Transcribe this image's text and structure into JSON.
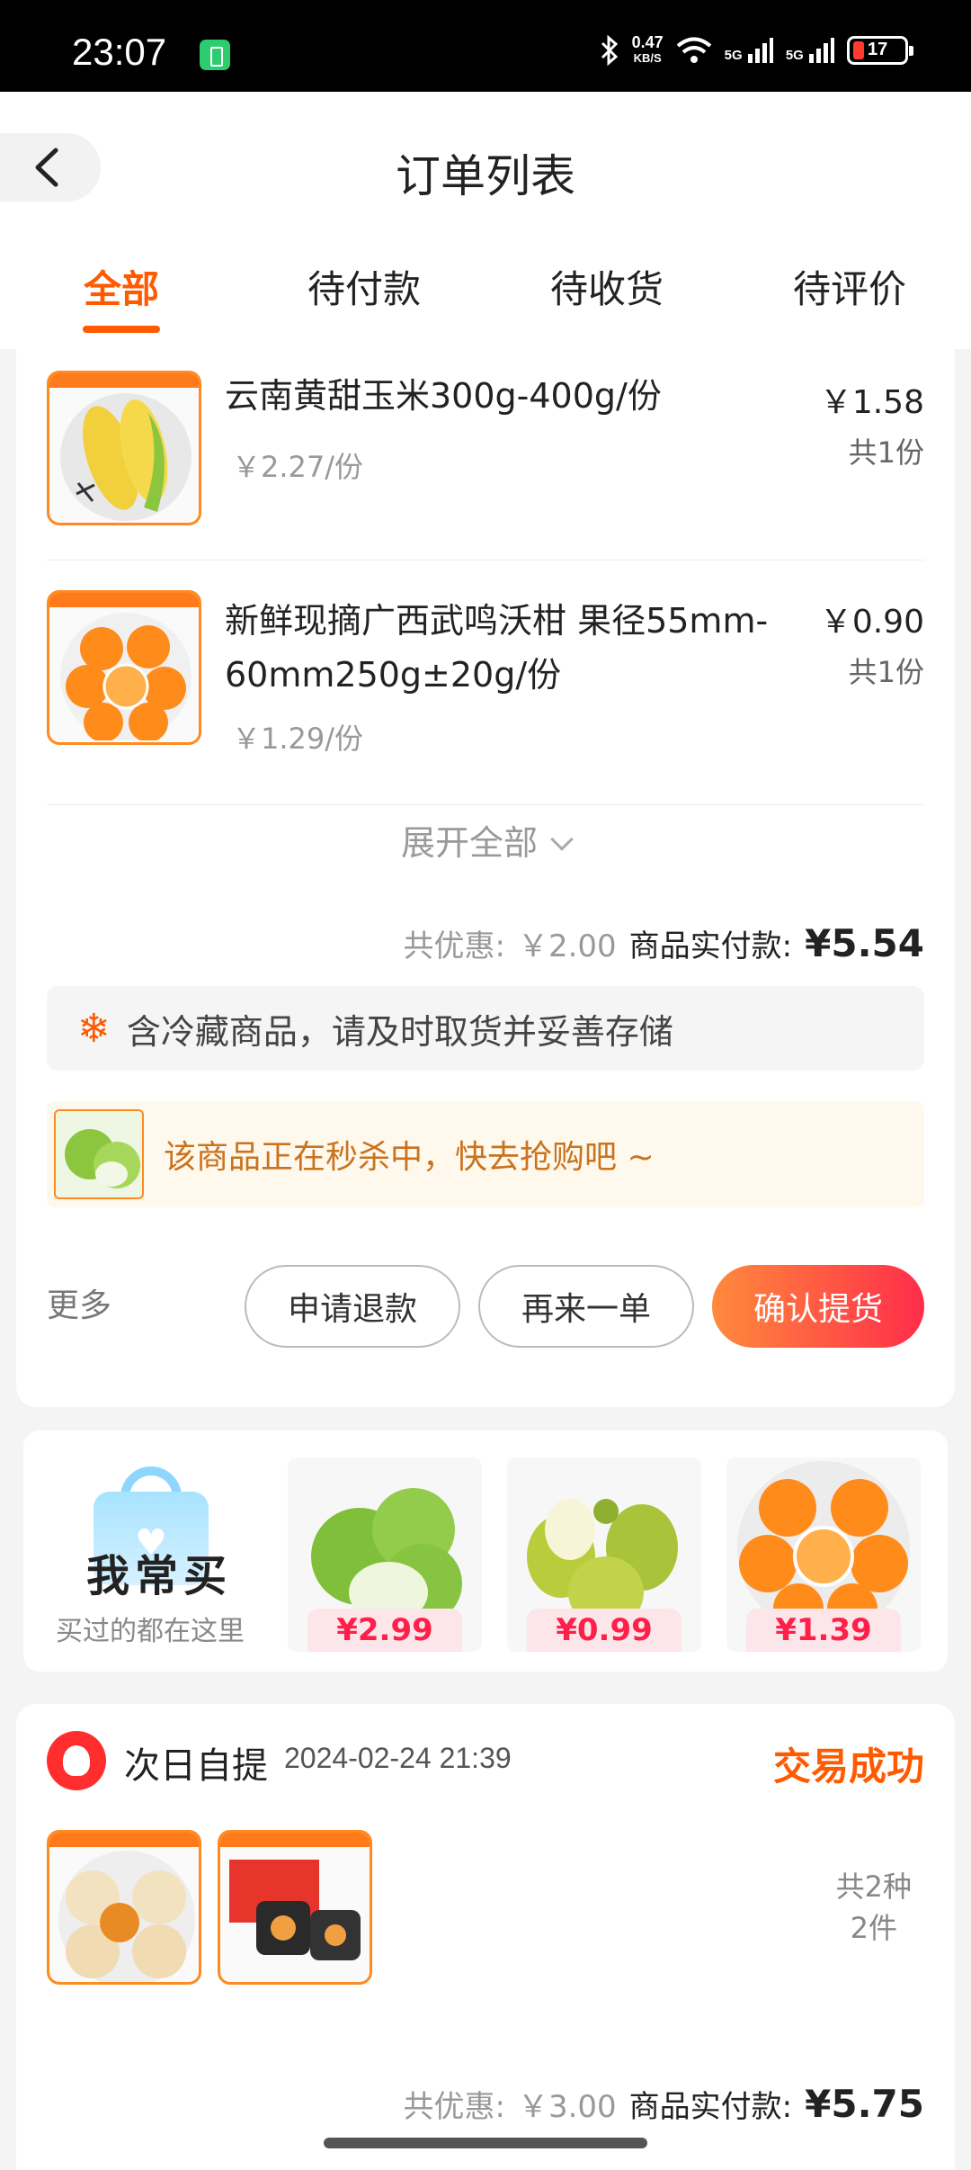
{
  "status_bar": {
    "time": "23:07",
    "net_speed_value": "0.47",
    "net_speed_unit": "KB/S",
    "signal1": "5G",
    "signal2": "5G",
    "battery": "17",
    "icons": [
      "battery-saver-icon",
      "bluetooth-icon",
      "wifi-icon",
      "signal-icon",
      "battery-icon"
    ]
  },
  "header": {
    "title": "订单列表",
    "tabs": [
      {
        "label": "全部",
        "active": true
      },
      {
        "label": "待付款"
      },
      {
        "label": "待收货"
      },
      {
        "label": "待评价"
      }
    ]
  },
  "order1": {
    "items": [
      {
        "name": "云南黄甜玉米300g-400g/份",
        "unit_price": "￥2.27/份",
        "price": "￥1.58",
        "qty": "共1份"
      },
      {
        "name": "新鲜现摘广西武鸣沃柑 果径55mm-60mm250g±20g/份",
        "unit_price": "￥1.29/份",
        "price": "￥0.90",
        "qty": "共1份"
      }
    ],
    "expand_label": "展开全部",
    "discount_label": "共优惠:",
    "discount_value": "￥2.00",
    "paid_label": "商品实付款:",
    "paid_value": "¥5.54",
    "cold_notice": "含冷藏商品，请及时取货并妥善存储",
    "flash_sale": "该商品正在秒杀中，快去抢购吧 ~",
    "more": "更多",
    "buttons": {
      "refund": "申请退款",
      "reorder": "再来一单",
      "confirm": "确认提货"
    }
  },
  "frequent": {
    "title": "我常买",
    "subtitle": "买过的都在这里",
    "products": [
      {
        "price": "¥2.99"
      },
      {
        "price": "¥0.99"
      },
      {
        "price": "¥1.39"
      }
    ]
  },
  "order2": {
    "shop": "次日自提",
    "time": "2024-02-24 21:39",
    "status": "交易成功",
    "count_kinds": "共2种",
    "count_items": "2件",
    "discount_label": "共优惠:",
    "discount_value": "￥3.00",
    "paid_label": "商品实付款:",
    "paid_value": "¥5.75"
  },
  "colors": {
    "accent": "#ff5a00",
    "price_red": "#ff1f4b",
    "flash_text": "#c9731e"
  }
}
